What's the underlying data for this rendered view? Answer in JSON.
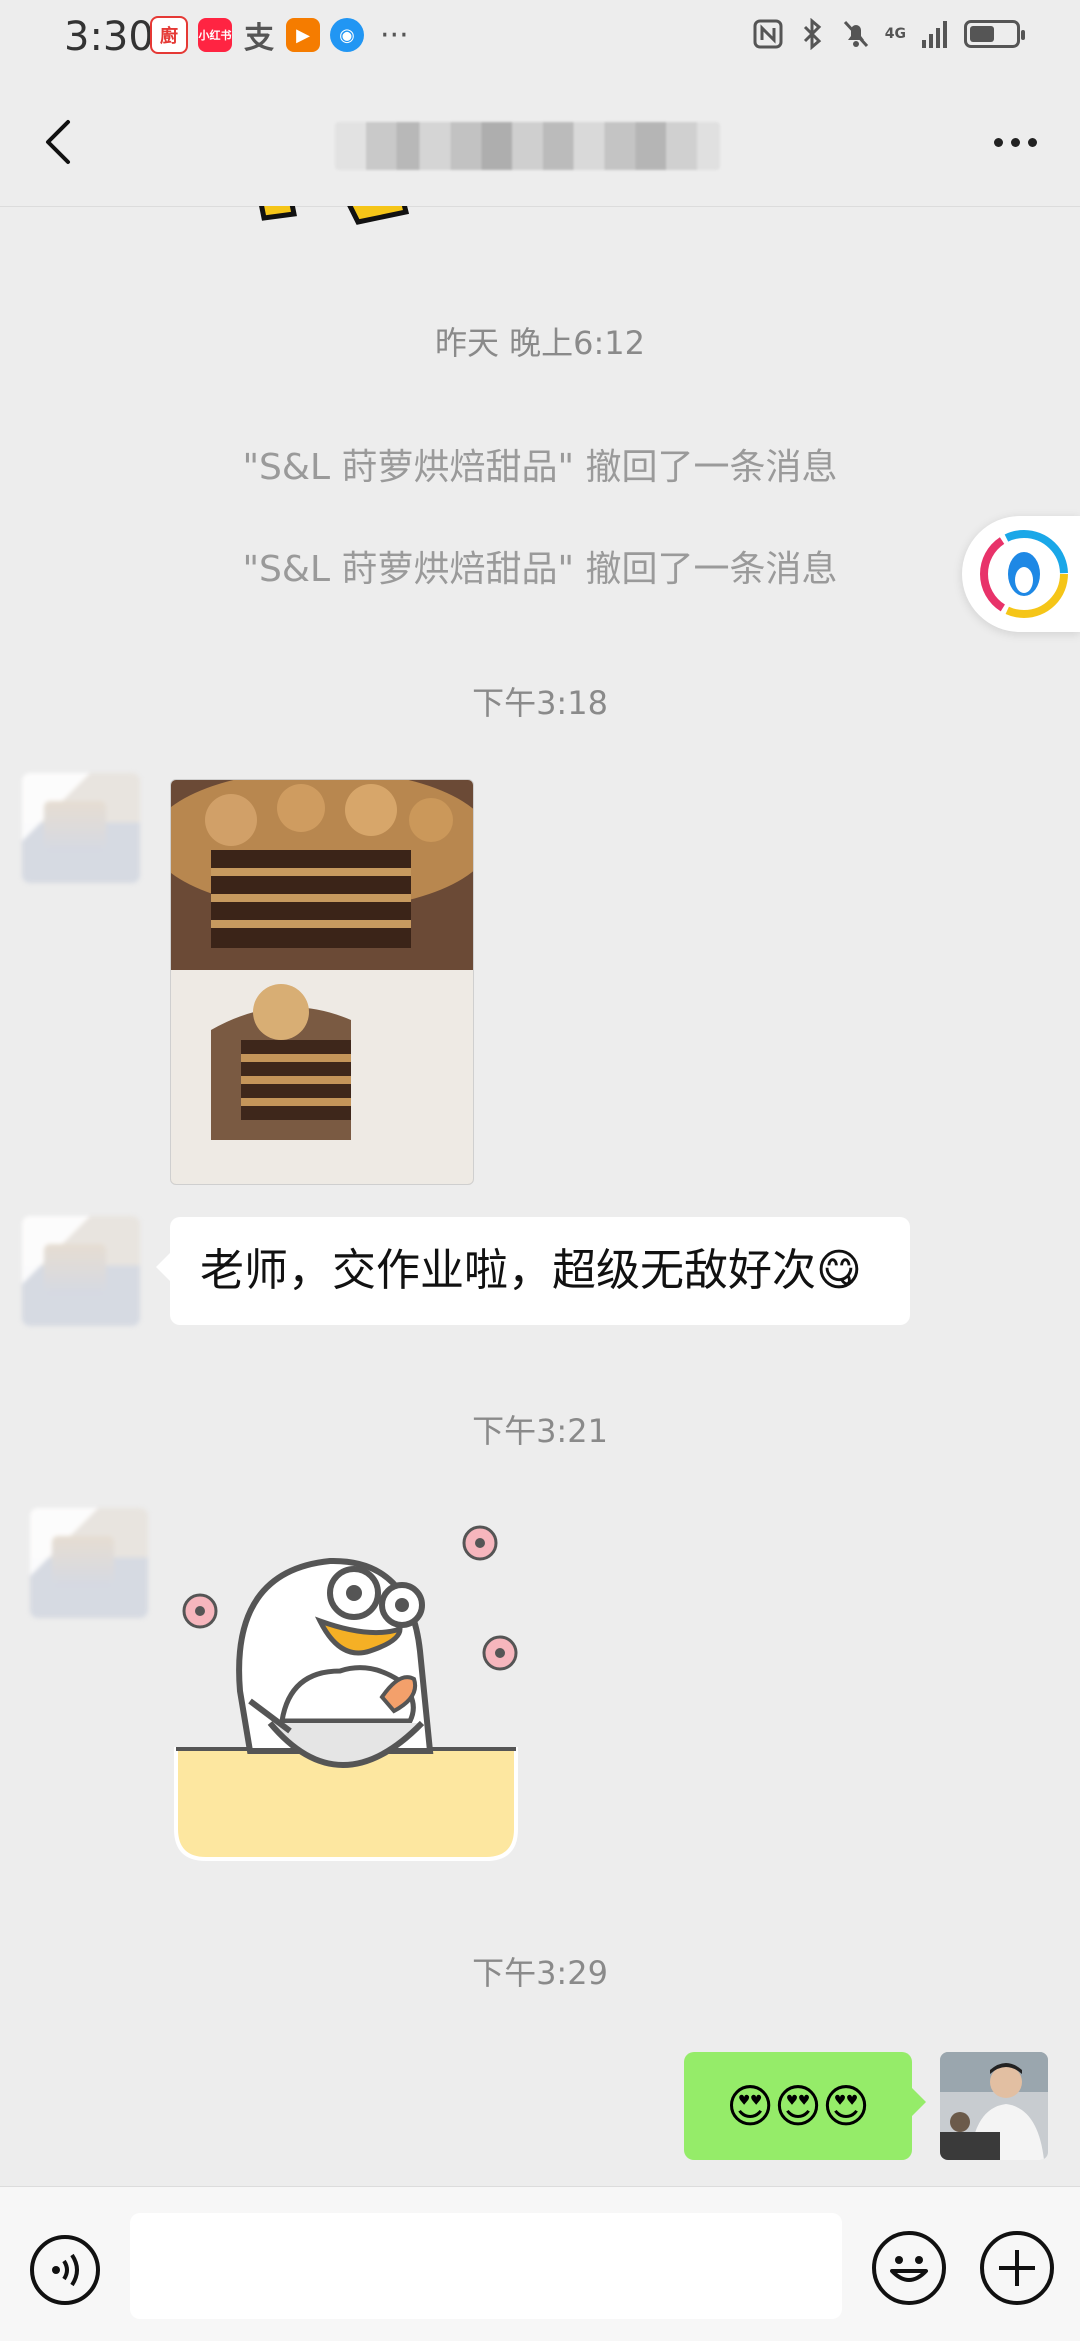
{
  "status_bar": {
    "time": "3:30",
    "apps": [
      {
        "icon": "app-rice-icon",
        "label": "廚",
        "color": "#e53935"
      },
      {
        "icon": "xiaohongshu-icon",
        "label": "小红书",
        "color": "#ff2442"
      },
      {
        "icon": "alipay-icon",
        "label": "支",
        "color": "#1677ff"
      },
      {
        "icon": "video-icon",
        "label": "▶",
        "color": "#f57c00"
      },
      {
        "icon": "browser-icon",
        "label": "◉",
        "color": "#2196f3"
      }
    ],
    "more": "···",
    "network": "4G",
    "battery_level": 0.55
  },
  "header": {
    "back_label": "‹",
    "more_label": "···"
  },
  "messages": {
    "ts_yesterday": "昨天 晚上6:12",
    "recall_1": "\"S&L 莳萝烘焙甜品\" 撤回了一条消息",
    "recall_2": "\"S&L 莳萝烘焙甜品\" 撤回了一条消息",
    "ts_318": "下午3:18",
    "text_msg": "老师，交作业啦，超级无敌好次😋",
    "ts_321": "下午3:21",
    "ts_329": "下午3:29",
    "my_msg": "😍😍😍"
  },
  "input_bar": {
    "placeholder": ""
  }
}
